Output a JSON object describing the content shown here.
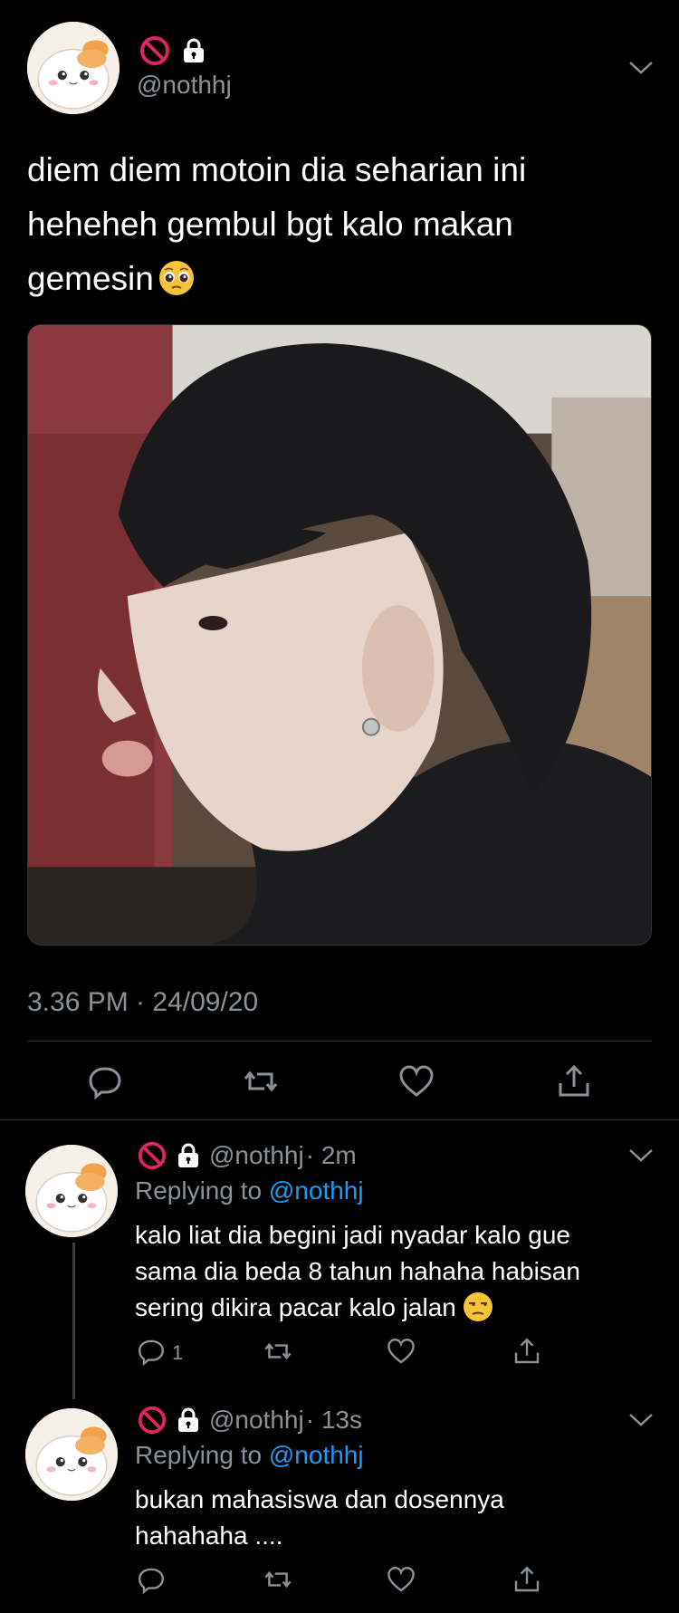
{
  "main_tweet": {
    "handle": "@nothhj",
    "text_lines": [
      "diem diem motoin dia seharian ini",
      "heheheh gembul bgt kalo makan",
      "gemesin"
    ],
    "timestamp": "3.36 PM · 24/09/20",
    "icons": [
      "no-entry-icon",
      "lock-icon"
    ],
    "actions": [
      "reply-icon",
      "retweet-icon",
      "like-icon",
      "share-icon"
    ]
  },
  "replies": [
    {
      "handle": "@nothhj",
      "time": "· 2m",
      "replying_prefix": "Replying to",
      "replying_to": "@nothhj",
      "text_lines": [
        "kalo liat dia begini jadi nyadar kalo gue",
        "sama dia beda 8 tahun hahaha habisan",
        "sering dikira pacar kalo jalan"
      ],
      "reply_count": "1"
    },
    {
      "handle": "@nothhj",
      "time": "· 13s",
      "replying_prefix": "Replying to",
      "replying_to": "@nothhj",
      "text_lines": [
        "bukan mahasiswa dan dosennya",
        "hahahaha ...."
      ],
      "reply_count": ""
    }
  ],
  "colors": {
    "background": "#000000",
    "secondary_text": "#8b9198",
    "mention": "#1d9bf0",
    "divider": "#2f3336"
  }
}
